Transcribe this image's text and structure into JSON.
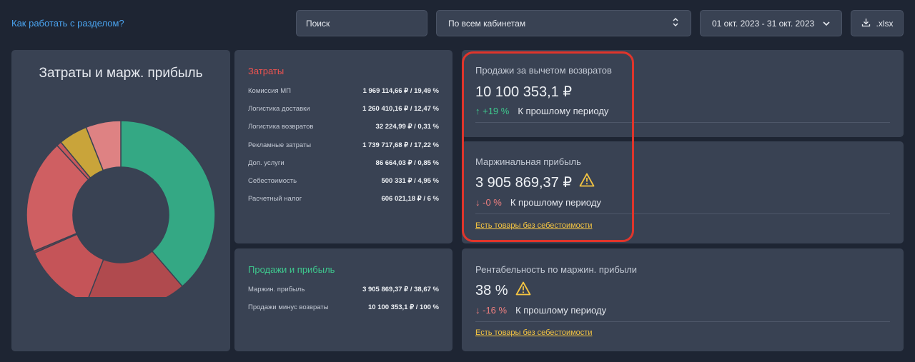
{
  "header": {
    "help_link": "Как работать с разделом?",
    "search_placeholder": "Поиск",
    "cabinet_select": "По всем кабинетам",
    "date_range": "01 окт. 2023 - 31 окт. 2023",
    "export_label": ".xlsx"
  },
  "donut": {
    "title": "Затраты и марж. прибыль",
    "segments": [
      {
        "name": "Маржин. прибыль",
        "value": 38.67,
        "color": "#34a884"
      },
      {
        "name": "Рекламные затраты",
        "value": 17.22,
        "color": "#b04a4e"
      },
      {
        "name": "Логистика доставки",
        "value": 12.47,
        "color": "#c55458"
      },
      {
        "name": "Логистика возвратов",
        "value": 0.31,
        "color": "#8a3a3c"
      },
      {
        "name": "Комиссия МП",
        "value": 19.49,
        "color": "#cf5f62"
      },
      {
        "name": "Доп. услуги",
        "value": 0.85,
        "color": "#c8585c"
      },
      {
        "name": "Себестоимость",
        "value": 4.95,
        "color": "#c9a43a"
      },
      {
        "name": "Расчетный налог",
        "value": 6.0,
        "color": "#de8283"
      }
    ]
  },
  "costs": {
    "title": "Затраты",
    "rows": [
      {
        "label": "Комиссия МП",
        "value": "1 969 114,66 ₽ / 19,49 %"
      },
      {
        "label": "Логистика доставки",
        "value": "1 260 410,16 ₽ / 12,47 %"
      },
      {
        "label": "Логистика возвратов",
        "value": "32 224,99 ₽ / 0,31 %"
      },
      {
        "label": "Рекламные затраты",
        "value": "1 739 717,68 ₽ / 17,22 %"
      },
      {
        "label": "Доп. услуги",
        "value": "86 664,03 ₽ / 0,85 %"
      },
      {
        "label": "Себестоимость",
        "value": "500 331 ₽ / 4,95 %"
      },
      {
        "label": "Расчетный налог",
        "value": "606 021,18 ₽ / 6 %"
      }
    ]
  },
  "profit": {
    "title": "Продажи и прибыль",
    "rows": [
      {
        "label": "Маржин. прибыль",
        "value": "3 905 869,37 ₽ / 38,67 %"
      },
      {
        "label": "Продажи минус возвраты",
        "value": "10 100 353,1 ₽ / 100 %"
      }
    ]
  },
  "metrics": {
    "sales": {
      "label": "Продажи за вычетом возвратов",
      "value": "10 100 353,1 ₽",
      "change": "↑ +19 %",
      "compare": "К прошлому периоду"
    },
    "margin": {
      "label": "Маржинальная прибыль",
      "value": "3 905 869,37 ₽",
      "change": "↓ -0 %",
      "compare": "К прошлому периоду",
      "warning_link": "Есть товары без себестоимости"
    },
    "profitability": {
      "label": "Рентабельность по маржин. прибыли",
      "value": "38 %",
      "change": "↓ -16 %",
      "compare": "К прошлому периоду",
      "warning_link": "Есть товары без себестоимости"
    }
  },
  "colors": {
    "background": "#1e2533",
    "card": "#394253",
    "accent_red": "#ef5350",
    "accent_green": "#3ec98e",
    "warning": "#f5c542",
    "link": "#4aa3ef",
    "highlight": "#e0352b"
  },
  "icons": {
    "cabinet_select": "sort-arrows-icon",
    "date_range": "chevron-down-icon",
    "export": "download-icon",
    "warning": "warning-triangle-icon"
  }
}
